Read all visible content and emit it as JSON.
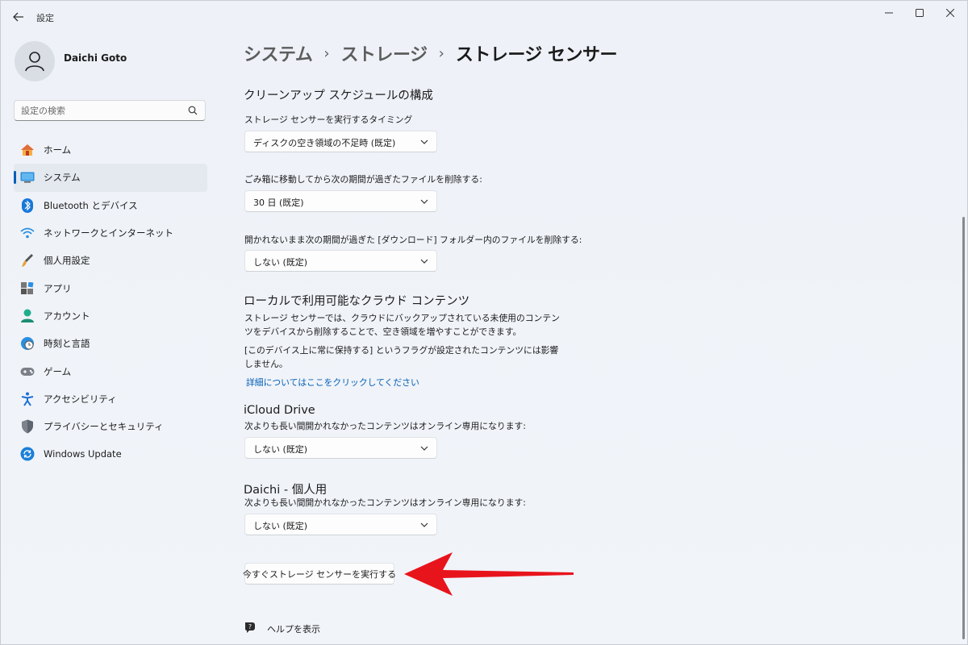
{
  "window": {
    "app_title": "設定",
    "controls": {
      "minimize": "minimize-icon",
      "maximize": "maximize-icon",
      "close": "close-icon"
    }
  },
  "profile": {
    "name": "Daichi Goto"
  },
  "search": {
    "placeholder": "設定の検索"
  },
  "sidebar": {
    "items": [
      {
        "label": "ホーム",
        "icon": "home-icon",
        "selected": false
      },
      {
        "label": "システム",
        "icon": "system-icon",
        "selected": true
      },
      {
        "label": "Bluetooth とデバイス",
        "icon": "bluetooth-icon",
        "selected": false
      },
      {
        "label": "ネットワークとインターネット",
        "icon": "wifi-icon",
        "selected": false
      },
      {
        "label": "個人用設定",
        "icon": "brush-icon",
        "selected": false
      },
      {
        "label": "アプリ",
        "icon": "apps-icon",
        "selected": false
      },
      {
        "label": "アカウント",
        "icon": "account-icon",
        "selected": false
      },
      {
        "label": "時刻と言語",
        "icon": "time-language-icon",
        "selected": false
      },
      {
        "label": "ゲーム",
        "icon": "gaming-icon",
        "selected": false
      },
      {
        "label": "アクセシビリティ",
        "icon": "accessibility-icon",
        "selected": false
      },
      {
        "label": "プライバシーとセキュリティ",
        "icon": "shield-icon",
        "selected": false
      },
      {
        "label": "Windows Update",
        "icon": "windows-update-icon",
        "selected": false
      }
    ]
  },
  "breadcrumb": {
    "items": [
      "システム",
      "ストレージ",
      "ストレージ センサー"
    ],
    "separator": "›"
  },
  "main": {
    "cleanup": {
      "title": "クリーンアップ スケジュールの構成",
      "run_timing_label": "ストレージ センサーを実行するタイミング",
      "run_timing_value": "ディスクの空き領域の不足時 (既定)",
      "recycle_label": "ごみ箱に移動してから次の期間が過ぎたファイルを削除する:",
      "recycle_value": "30 日 (既定)",
      "downloads_label": "開かれないまま次の期間が過ぎた [ダウンロード] フォルダー内のファイルを削除する:",
      "downloads_value": "しない (既定)"
    },
    "cloud": {
      "title": "ローカルで利用可能なクラウド コンテンツ",
      "desc1": "ストレージ センサーでは、クラウドにバックアップされている未使用のコンテンツをデバイスから削除することで、空き領域を増やすことができます。",
      "desc2": "[このデバイス上に常に保持する] というフラグが設定されたコンテンツには影響しません。",
      "link": "詳細についてはここをクリックしてください"
    },
    "icloud": {
      "title": "iCloud Drive",
      "label": "次よりも長い間開かれなかったコンテンツはオンライン専用になります:",
      "value": "しない (既定)"
    },
    "onedrive": {
      "title": "Daichi - 個人用",
      "label": "次よりも長い間開かれなかったコンテンツはオンライン専用になります:",
      "value": "しない (既定)"
    },
    "run_now_label": "今すぐストレージ センサーを実行する",
    "help_label": "ヘルプを表示"
  },
  "colors": {
    "accent": "#005fb8",
    "annotation_arrow": "#e8141c"
  }
}
